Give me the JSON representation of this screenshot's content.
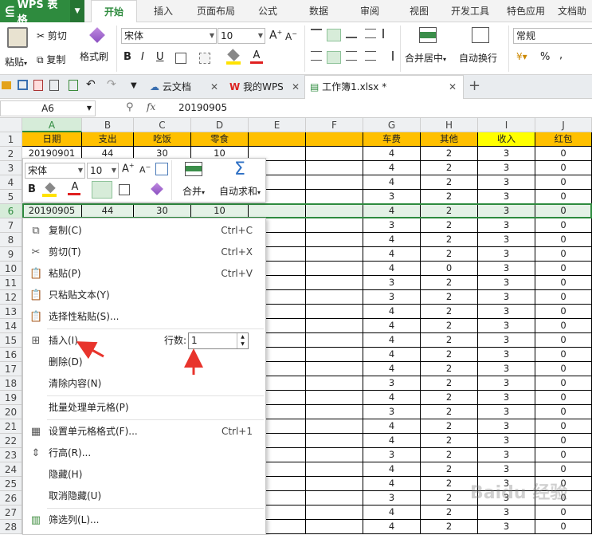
{
  "app": {
    "name": "WPS 表格"
  },
  "tabs": [
    "开始",
    "插入",
    "页面布局",
    "公式",
    "数据",
    "审阅",
    "视图",
    "开发工具",
    "特色应用",
    "文档助"
  ],
  "ribbon": {
    "paste": "粘贴",
    "cut": "剪切",
    "copy": "复制",
    "format_painter": "格式刷",
    "font": "宋体",
    "size": "10",
    "merge": "合并居中",
    "wrap": "自动换行",
    "number_format": "常规",
    "bold": "B",
    "italic": "I",
    "underline": "U",
    "font_color_letter": "A",
    "percent": "%"
  },
  "doc_tabs": {
    "cloud": "云文档",
    "mywps": "我的WPS",
    "file": "工作簿1.xlsx *",
    "add": "+"
  },
  "formula_bar": {
    "name_box": "A6",
    "fx": "fx",
    "value": "20190905"
  },
  "columns": [
    "A",
    "B",
    "C",
    "D",
    "E",
    "F",
    "G",
    "H",
    "I",
    "J"
  ],
  "row_numbers": [
    "1",
    "2",
    "3",
    "4",
    "5",
    "6",
    "7",
    "8",
    "9",
    "10",
    "11",
    "12",
    "13",
    "14",
    "15",
    "16",
    "17",
    "18",
    "19",
    "20",
    "21",
    "22",
    "23",
    "24",
    "25",
    "26",
    "27",
    "28"
  ],
  "header_row": [
    "日期",
    "支出",
    "吃饭",
    "零食",
    "",
    "",
    "车费",
    "其他",
    "收入",
    "红包"
  ],
  "row2_left": [
    "20190901",
    "44",
    "30",
    "10"
  ],
  "row6_left": [
    "20190905",
    "44",
    "30",
    "10"
  ],
  "right_data": [
    [
      "4",
      "2",
      "3",
      "0"
    ],
    [
      "4",
      "2",
      "3",
      "0"
    ],
    [
      "4",
      "2",
      "3",
      "0"
    ],
    [
      "3",
      "2",
      "3",
      "0"
    ],
    [
      "4",
      "2",
      "3",
      "0"
    ],
    [
      "3",
      "2",
      "3",
      "0"
    ],
    [
      "4",
      "2",
      "3",
      "0"
    ],
    [
      "4",
      "2",
      "3",
      "0"
    ],
    [
      "4",
      "0",
      "3",
      "0"
    ],
    [
      "3",
      "2",
      "3",
      "0"
    ],
    [
      "3",
      "2",
      "3",
      "0"
    ],
    [
      "4",
      "2",
      "3",
      "0"
    ],
    [
      "4",
      "2",
      "3",
      "0"
    ],
    [
      "4",
      "2",
      "3",
      "0"
    ],
    [
      "4",
      "2",
      "3",
      "0"
    ],
    [
      "4",
      "2",
      "3",
      "0"
    ],
    [
      "3",
      "2",
      "3",
      "0"
    ],
    [
      "4",
      "2",
      "3",
      "0"
    ],
    [
      "3",
      "2",
      "3",
      "0"
    ],
    [
      "4",
      "2",
      "3",
      "0"
    ],
    [
      "4",
      "2",
      "3",
      "0"
    ],
    [
      "3",
      "2",
      "3",
      "0"
    ],
    [
      "4",
      "2",
      "3",
      "0"
    ],
    [
      "4",
      "2",
      "3",
      "0"
    ],
    [
      "3",
      "2",
      "3",
      "0"
    ],
    [
      "4",
      "2",
      "3",
      "0"
    ],
    [
      "4",
      "2",
      "3",
      "0"
    ]
  ],
  "mini_toolbar": {
    "font": "宋体",
    "size": "10",
    "merge": "合并",
    "autosum": "自动求和",
    "bold": "B",
    "font_color_letter": "A"
  },
  "context_menu": {
    "copy": "复制(C)",
    "copy_sc": "Ctrl+C",
    "cut": "剪切(T)",
    "cut_sc": "Ctrl+X",
    "paste": "粘贴(P)",
    "paste_sc": "Ctrl+V",
    "paste_text": "只粘贴文本(Y)",
    "paste_special": "选择性粘贴(S)...",
    "insert": "插入(I)",
    "rows_label": "行数:",
    "rows_value": "1",
    "delete": "删除(D)",
    "clear": "清除内容(N)",
    "batch": "批量处理单元格(P)",
    "format_cells": "设置单元格格式(F)...",
    "format_cells_sc": "Ctrl+1",
    "row_height": "行高(R)...",
    "hide": "隐藏(H)",
    "unhide": "取消隐藏(U)",
    "filter": "筛选列(L)..."
  },
  "watermark": "Baidu 经验",
  "colors": {
    "brand": "#2e8b3e",
    "header_orange": "#ffc000",
    "header_yellow": "#ffff00",
    "annotation_red": "#e8342c"
  }
}
